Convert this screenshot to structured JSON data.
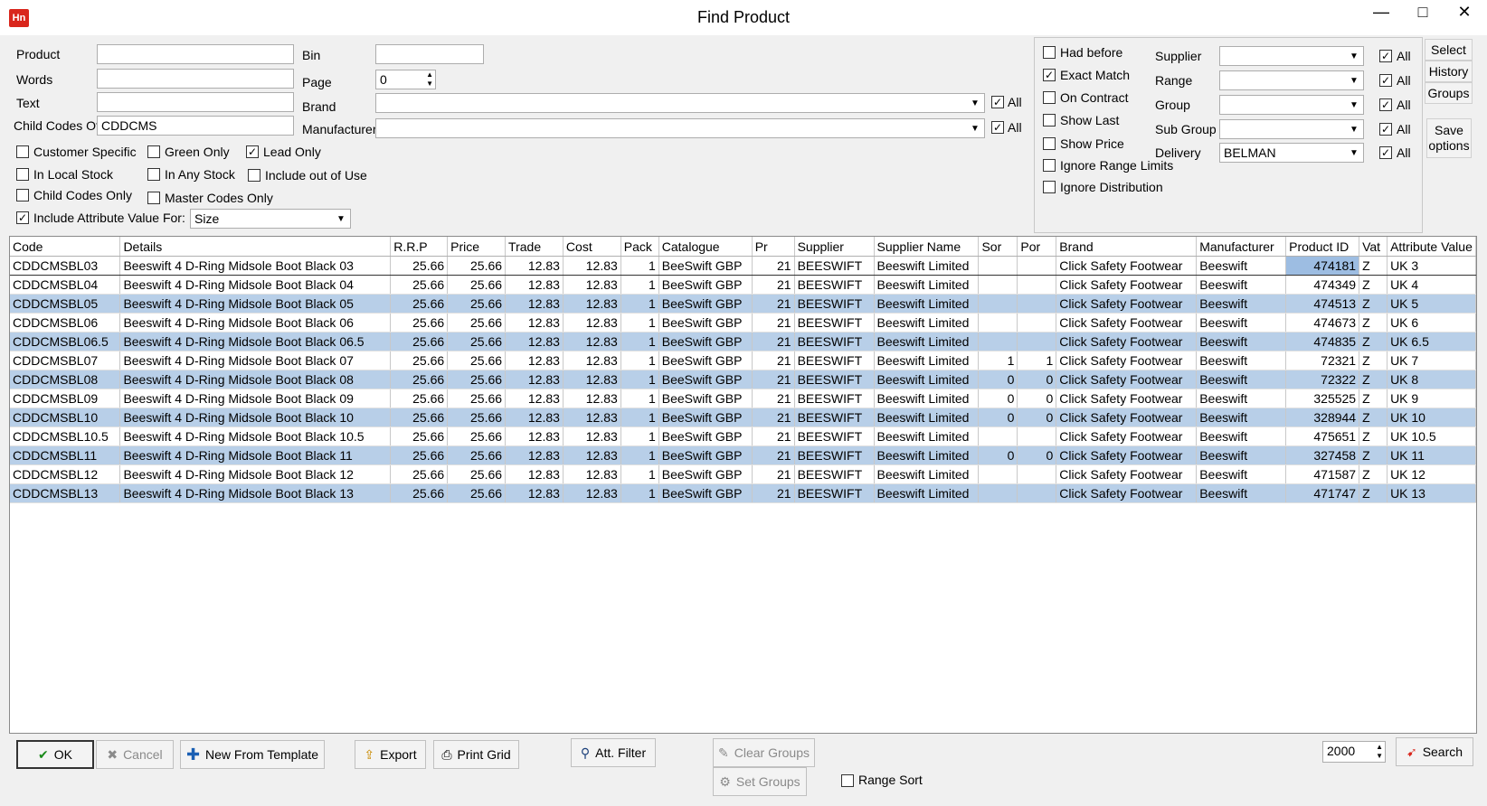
{
  "window": {
    "title": "Find Product",
    "icon_text": "Hn",
    "minimize": "—",
    "maximize": "□",
    "close": "✕"
  },
  "form": {
    "product_label": "Product",
    "product_value": "",
    "words_label": "Words",
    "words_value": "",
    "text_label": "Text",
    "text_value": "",
    "child_codes_label": "Child Codes Of",
    "child_codes_value": "CDDCMS",
    "bin_label": "Bin",
    "bin_value": "",
    "page_label": "Page",
    "page_value": "0",
    "brand_label": "Brand",
    "brand_value": "",
    "manufacturer_label": "Manufacturer",
    "manufacturer_value": "",
    "all_label": "All",
    "attr_combo_value": "Size"
  },
  "checkboxes_left": [
    {
      "label": "Customer Specific",
      "checked": false
    },
    {
      "label": "Green Only",
      "checked": false
    },
    {
      "label": "Lead Only",
      "checked": true
    },
    {
      "label": "In Local Stock",
      "checked": false
    },
    {
      "label": "In Any Stock",
      "checked": false
    },
    {
      "label": "Include out of Use",
      "checked": false
    },
    {
      "label": "Child Codes Only",
      "checked": false
    },
    {
      "label": "Master Codes Only",
      "checked": false
    },
    {
      "label": "Include Attribute Value For:",
      "checked": true
    }
  ],
  "checkboxes_right": [
    {
      "label": "Had before",
      "checked": false
    },
    {
      "label": "Exact Match",
      "checked": true
    },
    {
      "label": "On Contract",
      "checked": false
    },
    {
      "label": "Show Last",
      "checked": false
    },
    {
      "label": "Show Price",
      "checked": false
    },
    {
      "label": "Ignore Range Limits",
      "checked": false
    },
    {
      "label": "Ignore Distribution",
      "checked": false
    }
  ],
  "filters_right": [
    {
      "label": "Supplier",
      "value": ""
    },
    {
      "label": "Range",
      "value": ""
    },
    {
      "label": "Group",
      "value": ""
    },
    {
      "label": "Sub Group",
      "value": ""
    },
    {
      "label": "Delivery",
      "value": "BELMAN"
    }
  ],
  "side_buttons": {
    "select": "Select",
    "history": "History",
    "groups": "Groups",
    "save_options_1": "Save",
    "save_options_2": "options"
  },
  "grid": {
    "columns": [
      "Code",
      "Details",
      "R.R.P",
      "Price",
      "Trade",
      "Cost",
      "Pack",
      "Catalogue",
      "Pr",
      "Supplier",
      "Supplier Name",
      "Sor",
      "Por",
      "Brand",
      "Manufacturer",
      "Product ID",
      "Vat",
      "Attribute Value"
    ],
    "rows": [
      [
        "CDDCMSBL03",
        "Beeswift 4 D-Ring Midsole Boot Black 03",
        "25.66",
        "25.66",
        "12.83",
        "12.83",
        "1",
        "BeeSwift GBP",
        "21",
        "BEESWIFT",
        "Beeswift Limited",
        "",
        "",
        "Click Safety Footwear",
        "Beeswift",
        "474181",
        "Z",
        "UK 3"
      ],
      [
        "CDDCMSBL04",
        "Beeswift 4 D-Ring Midsole Boot Black 04",
        "25.66",
        "25.66",
        "12.83",
        "12.83",
        "1",
        "BeeSwift GBP",
        "21",
        "BEESWIFT",
        "Beeswift Limited",
        "",
        "",
        "Click Safety Footwear",
        "Beeswift",
        "474349",
        "Z",
        "UK 4"
      ],
      [
        "CDDCMSBL05",
        "Beeswift 4 D-Ring Midsole Boot Black 05",
        "25.66",
        "25.66",
        "12.83",
        "12.83",
        "1",
        "BeeSwift GBP",
        "21",
        "BEESWIFT",
        "Beeswift Limited",
        "",
        "",
        "Click Safety Footwear",
        "Beeswift",
        "474513",
        "Z",
        "UK 5"
      ],
      [
        "CDDCMSBL06",
        "Beeswift 4 D-Ring Midsole Boot Black 06",
        "25.66",
        "25.66",
        "12.83",
        "12.83",
        "1",
        "BeeSwift GBP",
        "21",
        "BEESWIFT",
        "Beeswift Limited",
        "",
        "",
        "Click Safety Footwear",
        "Beeswift",
        "474673",
        "Z",
        "UK 6"
      ],
      [
        "CDDCMSBL06.5",
        "Beeswift 4 D-Ring Midsole Boot Black 06.5",
        "25.66",
        "25.66",
        "12.83",
        "12.83",
        "1",
        "BeeSwift GBP",
        "21",
        "BEESWIFT",
        "Beeswift Limited",
        "",
        "",
        "Click Safety Footwear",
        "Beeswift",
        "474835",
        "Z",
        "UK 6.5"
      ],
      [
        "CDDCMSBL07",
        "Beeswift 4 D-Ring Midsole Boot Black 07",
        "25.66",
        "25.66",
        "12.83",
        "12.83",
        "1",
        "BeeSwift GBP",
        "21",
        "BEESWIFT",
        "Beeswift Limited",
        "1",
        "1",
        "Click Safety Footwear",
        "Beeswift",
        "72321",
        "Z",
        "UK 7"
      ],
      [
        "CDDCMSBL08",
        "Beeswift 4 D-Ring Midsole Boot Black 08",
        "25.66",
        "25.66",
        "12.83",
        "12.83",
        "1",
        "BeeSwift GBP",
        "21",
        "BEESWIFT",
        "Beeswift Limited",
        "0",
        "0",
        "Click Safety Footwear",
        "Beeswift",
        "72322",
        "Z",
        "UK 8"
      ],
      [
        "CDDCMSBL09",
        "Beeswift 4 D-Ring Midsole Boot Black 09",
        "25.66",
        "25.66",
        "12.83",
        "12.83",
        "1",
        "BeeSwift GBP",
        "21",
        "BEESWIFT",
        "Beeswift Limited",
        "0",
        "0",
        "Click Safety Footwear",
        "Beeswift",
        "325525",
        "Z",
        "UK 9"
      ],
      [
        "CDDCMSBL10",
        "Beeswift 4 D-Ring Midsole Boot Black 10",
        "25.66",
        "25.66",
        "12.83",
        "12.83",
        "1",
        "BeeSwift GBP",
        "21",
        "BEESWIFT",
        "Beeswift Limited",
        "0",
        "0",
        "Click Safety Footwear",
        "Beeswift",
        "328944",
        "Z",
        "UK 10"
      ],
      [
        "CDDCMSBL10.5",
        "Beeswift 4 D-Ring Midsole Boot Black 10.5",
        "25.66",
        "25.66",
        "12.83",
        "12.83",
        "1",
        "BeeSwift GBP",
        "21",
        "BEESWIFT",
        "Beeswift Limited",
        "",
        "",
        "Click Safety Footwear",
        "Beeswift",
        "475651",
        "Z",
        "UK 10.5"
      ],
      [
        "CDDCMSBL11",
        "Beeswift 4 D-Ring Midsole Boot Black 11",
        "25.66",
        "25.66",
        "12.83",
        "12.83",
        "1",
        "BeeSwift GBP",
        "21",
        "BEESWIFT",
        "Beeswift Limited",
        "0",
        "0",
        "Click Safety Footwear",
        "Beeswift",
        "327458",
        "Z",
        "UK 11"
      ],
      [
        "CDDCMSBL12",
        "Beeswift 4 D-Ring Midsole Boot Black 12",
        "25.66",
        "25.66",
        "12.83",
        "12.83",
        "1",
        "BeeSwift GBP",
        "21",
        "BEESWIFT",
        "Beeswift Limited",
        "",
        "",
        "Click Safety Footwear",
        "Beeswift",
        "471587",
        "Z",
        "UK 12"
      ],
      [
        "CDDCMSBL13",
        "Beeswift 4 D-Ring Midsole Boot Black 13",
        "25.66",
        "25.66",
        "12.83",
        "12.83",
        "1",
        "BeeSwift GBP",
        "21",
        "BEESWIFT",
        "Beeswift Limited",
        "",
        "",
        "Click Safety Footwear",
        "Beeswift",
        "471747",
        "Z",
        "UK 13"
      ]
    ]
  },
  "bottom": {
    "ok": "OK",
    "cancel": "Cancel",
    "new_from_template": "New From Template",
    "export": "Export",
    "print_grid": "Print Grid",
    "att_filter": "Att. Filter",
    "clear_groups": "Clear Groups",
    "set_groups": "Set Groups",
    "range_sort": "Range Sort",
    "max_rows": "2000",
    "search": "Search"
  },
  "colors": {
    "accent_row": "#b8cfe8",
    "app_icon": "#d9261c"
  }
}
